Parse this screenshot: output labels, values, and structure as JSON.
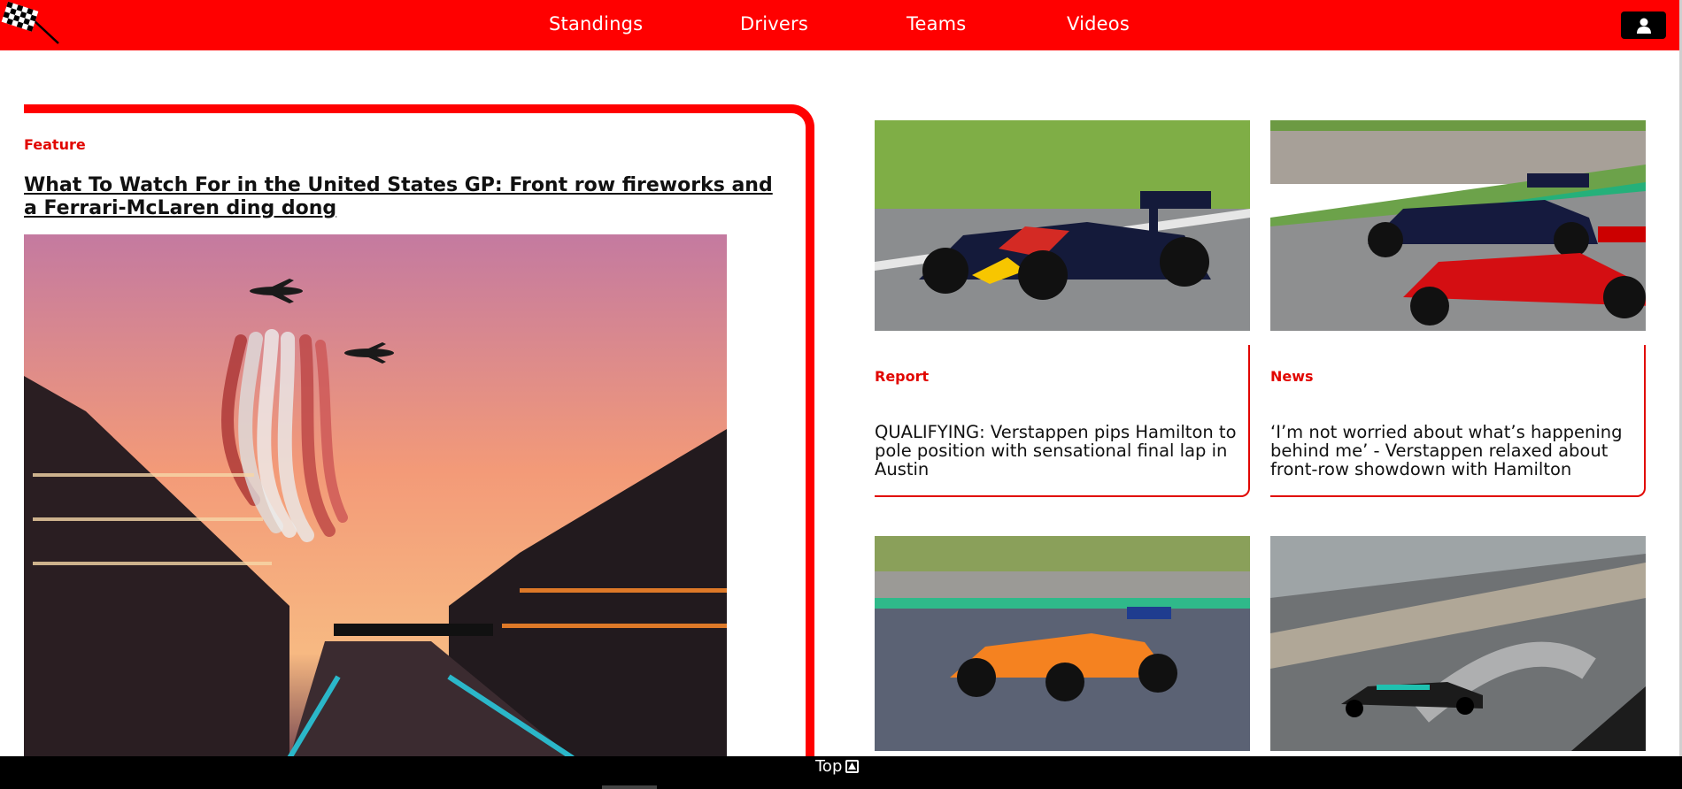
{
  "header": {
    "nav": [
      "Standings",
      "Drivers",
      "Teams",
      "Videos"
    ],
    "logo_icon": "checkered-flag-icon",
    "user_icon": "user-icon",
    "brand_color": "#ff0000"
  },
  "feature": {
    "tag": "Feature",
    "title": "What To Watch For in the United States GP: Front row fireworks and a Ferrari-McLaren ding dong",
    "image": "sunset-airshow-grandstand-photo"
  },
  "cards": [
    {
      "tag": "Report",
      "title": "QUALIFYING: Verstappen pips Hamilton to pole position with sensational final lap in Austin",
      "image": "red-bull-car-photo"
    },
    {
      "tag": "News",
      "title": "‘I’m not worried about what’s happening behind me’ - Verstappen relaxed about front-row showdown with Hamilton",
      "image": "red-bull-ferrari-battle-photo"
    },
    {
      "image": "mclaren-car-photo"
    },
    {
      "image": "mercedes-wet-track-photo"
    }
  ],
  "footer": {
    "top_label": "Top",
    "top_icon": "arrow-up-box-icon"
  }
}
